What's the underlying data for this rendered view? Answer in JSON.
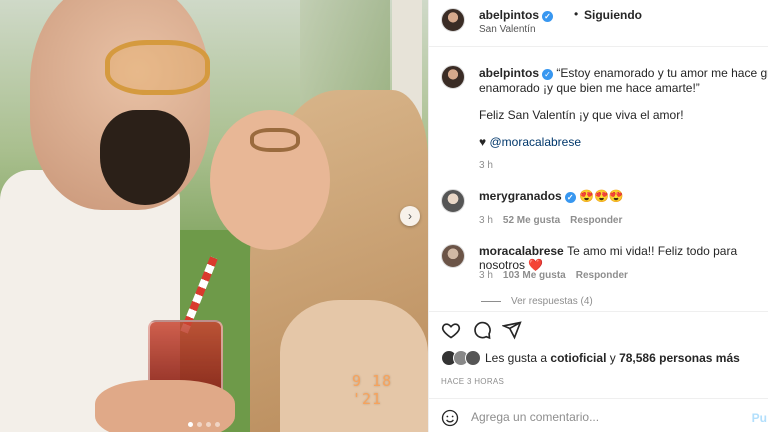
{
  "photo": {
    "date_stamp": "9 18 '21",
    "next_icon": "chevron-right-icon",
    "carousel_dots": 4,
    "active_dot": 0
  },
  "header": {
    "username": "abelpintos",
    "verified_icon": "verified-badge-icon",
    "separator": "•",
    "follow_status": "Siguiendo",
    "location": "San Valentín"
  },
  "caption": {
    "username": "abelpintos",
    "text_line1": "“Estoy enamorado y tu amor me hace grande, e",
    "text_line2": "enamorado ¡y que bien me hace amarte!”",
    "text_line3": "Feliz San Valentín ¡y que viva el amor!",
    "heart": "♥",
    "mention": "@moracalabrese",
    "time": "3 h"
  },
  "comments": [
    {
      "username": "merygranados",
      "verified": true,
      "text": "😍😍😍",
      "time": "3 h",
      "likes": "52 Me gusta",
      "reply_label": "Responder"
    },
    {
      "username": "moracalabrese",
      "verified": false,
      "text": "Te amo mi vida!! Feliz todo para nosotros ❤️",
      "time": "3 h",
      "likes": "103 Me gusta",
      "reply_label": "Responder"
    }
  ],
  "view_replies": "Ver respuestas (4)",
  "actions": {
    "like_icon": "heart-icon",
    "comment_icon": "comment-icon",
    "share_icon": "share-icon"
  },
  "likes": {
    "prefix": "Les gusta a ",
    "user": "cotioficial",
    "middle": " y ",
    "count": "78,586 personas más"
  },
  "post_time": "HACE 3 HORAS",
  "add_comment": {
    "emoji_icon": "emoji-icon",
    "placeholder": "Agrega un comentario...",
    "publish_label": "Pu"
  },
  "colors": {
    "verified": "#3897f0",
    "link": "#00376b",
    "publish_disabled": "#b2dffc"
  }
}
